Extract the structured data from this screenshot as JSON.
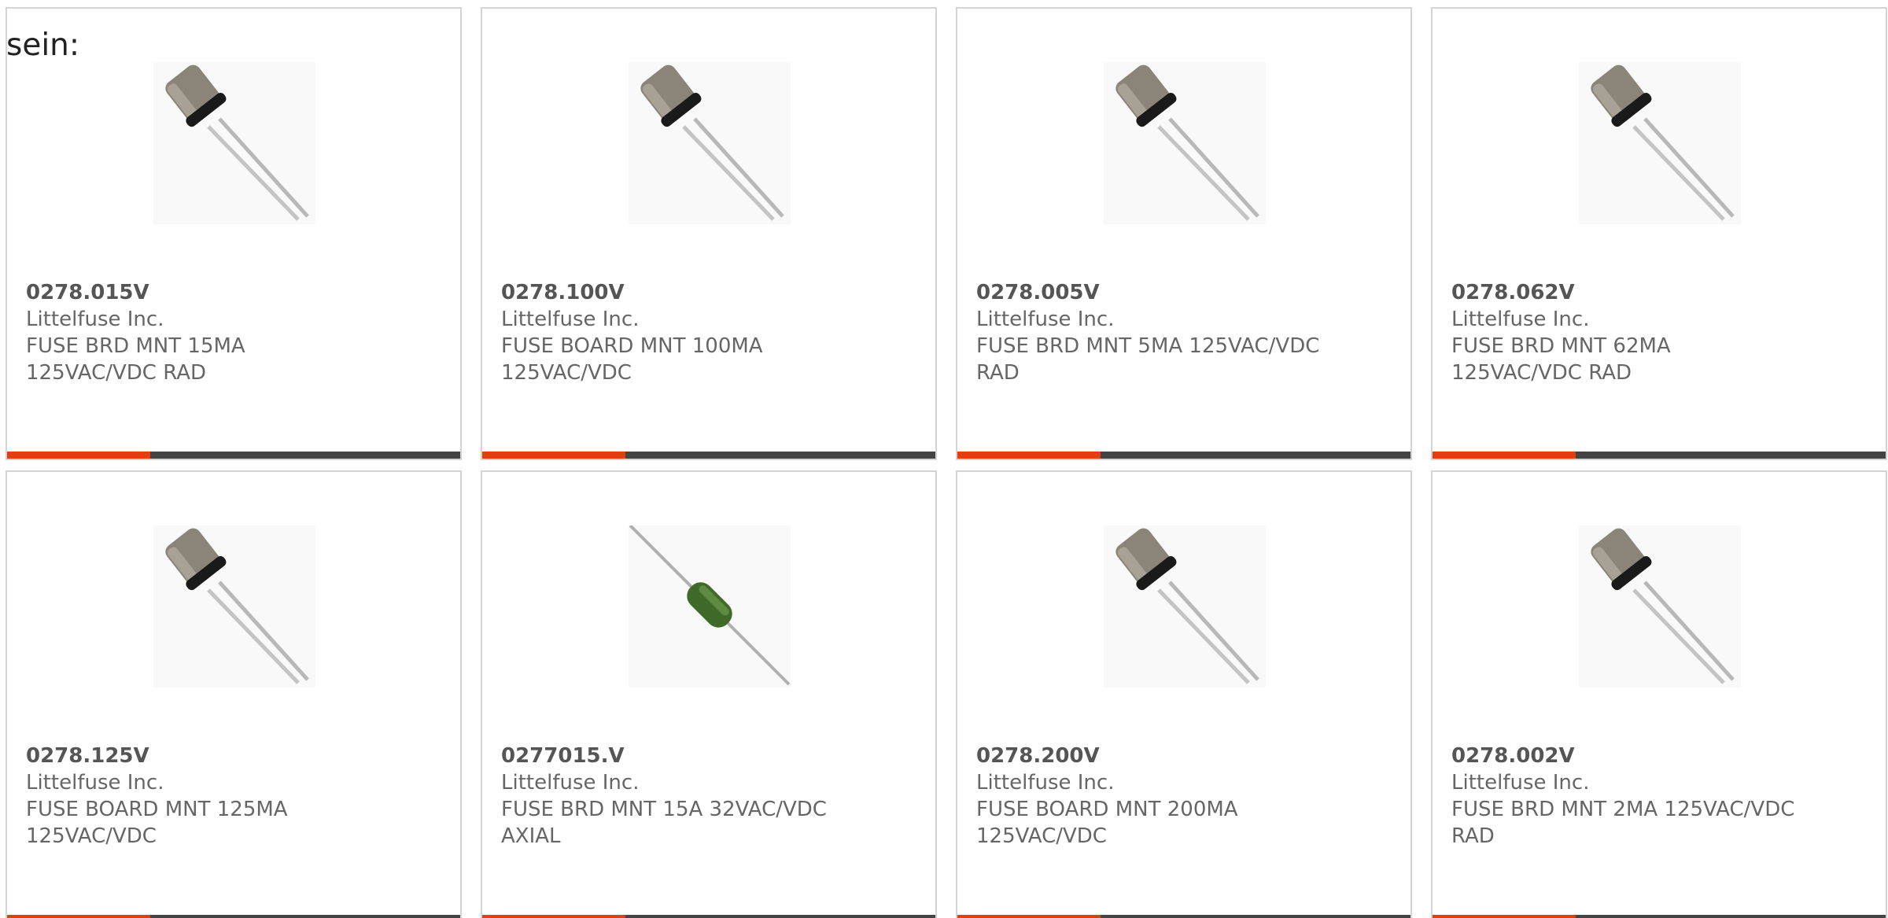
{
  "intro_text": "sein:",
  "colors": {
    "accent": "#e0400e",
    "bar": "#444444",
    "border": "#d4d4d4",
    "text": "#666666"
  },
  "products": [
    {
      "part": "0278.015V",
      "manufacturer": "Littelfuse Inc.",
      "description": "FUSE BRD MNT 15MA 125VAC/VDC RAD",
      "image": "radial-fuse-image"
    },
    {
      "part": "0278.100V",
      "manufacturer": "Littelfuse Inc.",
      "description": "FUSE BOARD MNT 100MA 125VAC/VDC",
      "image": "radial-fuse-image"
    },
    {
      "part": "0278.005V",
      "manufacturer": "Littelfuse Inc.",
      "description": "FUSE BRD MNT 5MA 125VAC/VDC RAD",
      "image": "radial-fuse-image"
    },
    {
      "part": "0278.062V",
      "manufacturer": "Littelfuse Inc.",
      "description": "FUSE BRD MNT 62MA 125VAC/VDC RAD",
      "image": "radial-fuse-image"
    },
    {
      "part": "0278.125V",
      "manufacturer": "Littelfuse Inc.",
      "description": "FUSE BOARD MNT 125MA 125VAC/VDC",
      "image": "radial-fuse-image"
    },
    {
      "part": "0277015.V",
      "manufacturer": "Littelfuse Inc.",
      "description": "FUSE BRD MNT 15A 32VAC/VDC AXIAL",
      "image": "axial-fuse-image"
    },
    {
      "part": "0278.200V",
      "manufacturer": "Littelfuse Inc.",
      "description": "FUSE BOARD MNT 200MA 125VAC/VDC",
      "image": "radial-fuse-image"
    },
    {
      "part": "0278.002V",
      "manufacturer": "Littelfuse Inc.",
      "description": "FUSE BRD MNT 2MA 125VAC/VDC RAD",
      "image": "radial-fuse-image"
    }
  ]
}
